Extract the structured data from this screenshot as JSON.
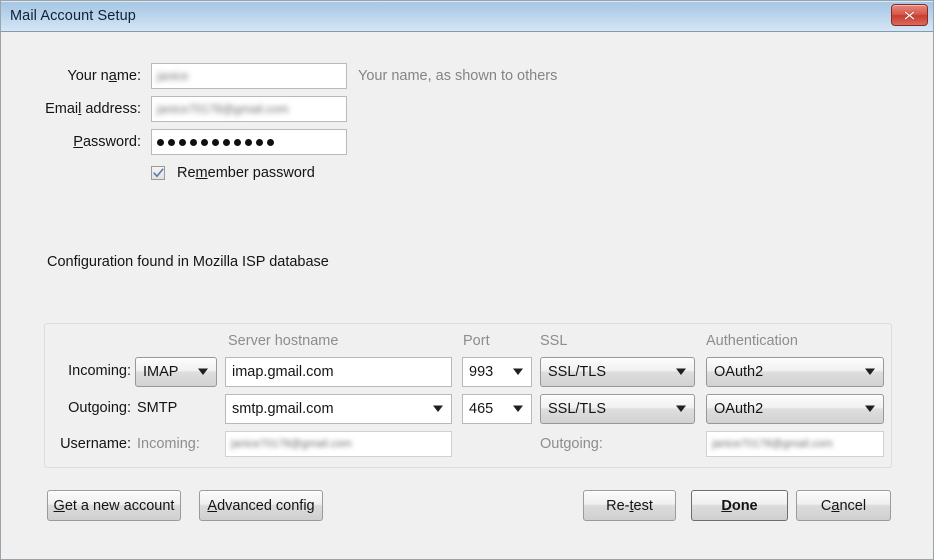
{
  "window": {
    "title": "Mail Account Setup",
    "close_icon": "close-icon"
  },
  "form": {
    "name_label_pre": "Your n",
    "name_label_acc": "a",
    "name_label_post": "me:",
    "name_label_full": "Your name:",
    "name_value": "janice",
    "name_hint": "Your name, as shown to others",
    "email_label_pre": "Emai",
    "email_label_acc": "l",
    "email_label_post": " address:",
    "email_label_full": "Email address:",
    "email_value": "janice70178@gmail.com",
    "password_label_pre": "",
    "password_label_acc": "P",
    "password_label_post": "assword:",
    "password_label_full": "Password:",
    "password_dots": 11,
    "remember_label_pre": "Re",
    "remember_label_acc": "m",
    "remember_label_post": "ember password",
    "remember_label_full": "Remember password",
    "remember_checked": true
  },
  "status": {
    "message": "Configuration found in Mozilla ISP database"
  },
  "server": {
    "headers": {
      "hostname": "Server hostname",
      "port": "Port",
      "ssl": "SSL",
      "auth": "Authentication"
    },
    "incoming": {
      "row_label": "Incoming:",
      "protocol": "IMAP",
      "hostname": "imap.gmail.com",
      "port": "993",
      "ssl": "SSL/TLS",
      "auth": "OAuth2"
    },
    "outgoing": {
      "row_label": "Outgoing:",
      "protocol": "SMTP",
      "hostname": "smtp.gmail.com",
      "port": "465",
      "ssl": "SSL/TLS",
      "auth": "OAuth2"
    },
    "username": {
      "row_label": "Username:",
      "incoming_label": "Incoming:",
      "incoming_value": "janice70178@gmail.com",
      "outgoing_label": "Outgoing:",
      "outgoing_value": "janice70178@gmail.com"
    }
  },
  "buttons": {
    "get_account_pre": "",
    "get_account_acc": "G",
    "get_account_post": "et a new account",
    "get_account_full": "Get a new account",
    "advanced_pre": "",
    "advanced_acc": "A",
    "advanced_post": "dvanced config",
    "advanced_full": "Advanced config",
    "retest_pre": "Re-",
    "retest_acc": "t",
    "retest_post": "est",
    "retest_full": "Re-test",
    "done_pre": "",
    "done_acc": "D",
    "done_post": "one",
    "done_full": "Done",
    "cancel_pre": "C",
    "cancel_acc": "a",
    "cancel_post": "ncel",
    "cancel_full": "Cancel"
  },
  "colors": {
    "titlebar_top": "#a6c6e3",
    "titlebar_bottom": "#d6e6f4",
    "close_red": "#c83c2f",
    "background": "#f0f0f0",
    "text": "#141414",
    "muted_text": "#8d8d8d"
  }
}
